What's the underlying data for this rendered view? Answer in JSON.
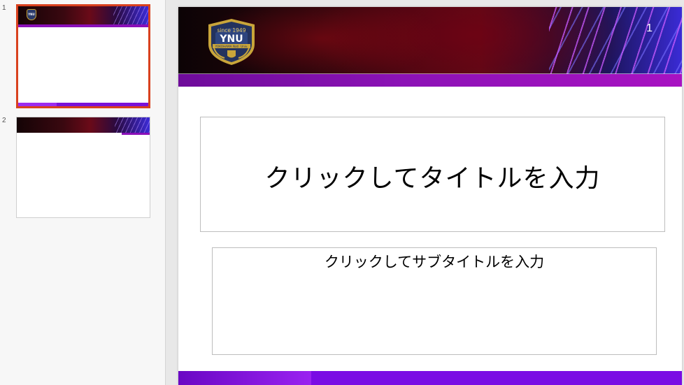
{
  "thumbnails": [
    {
      "number": "1",
      "selected": true
    },
    {
      "number": "2",
      "selected": false
    }
  ],
  "slide": {
    "number": "1",
    "title_placeholder": "クリックしてタイトルを入力",
    "subtitle_placeholder": "クリックしてサブタイトルを入力",
    "logo": {
      "text": "YNU",
      "since": "since 1949",
      "caption": "YOKOHAMA Natl. Univ."
    }
  },
  "colors": {
    "selection_border": "#d9411e",
    "purple_bar": "#8c12b6",
    "footer_bar": "#7a0ce4"
  }
}
